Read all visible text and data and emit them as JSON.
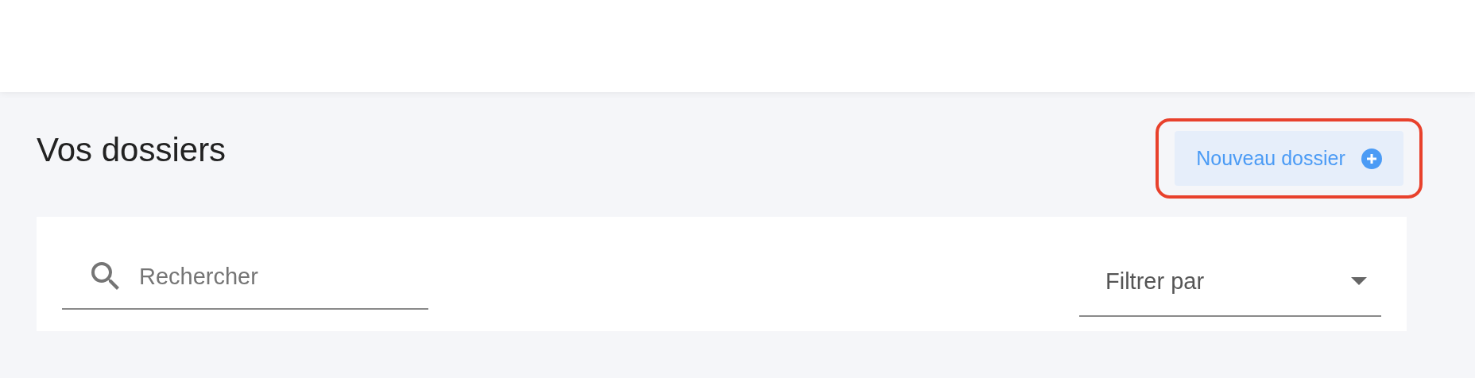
{
  "page_title": "Vos dossiers",
  "new_folder_button": {
    "label": "Nouveau dossier",
    "highlighted": true
  },
  "search": {
    "placeholder": "Rechercher"
  },
  "filter": {
    "placeholder": "Filtrer par"
  }
}
